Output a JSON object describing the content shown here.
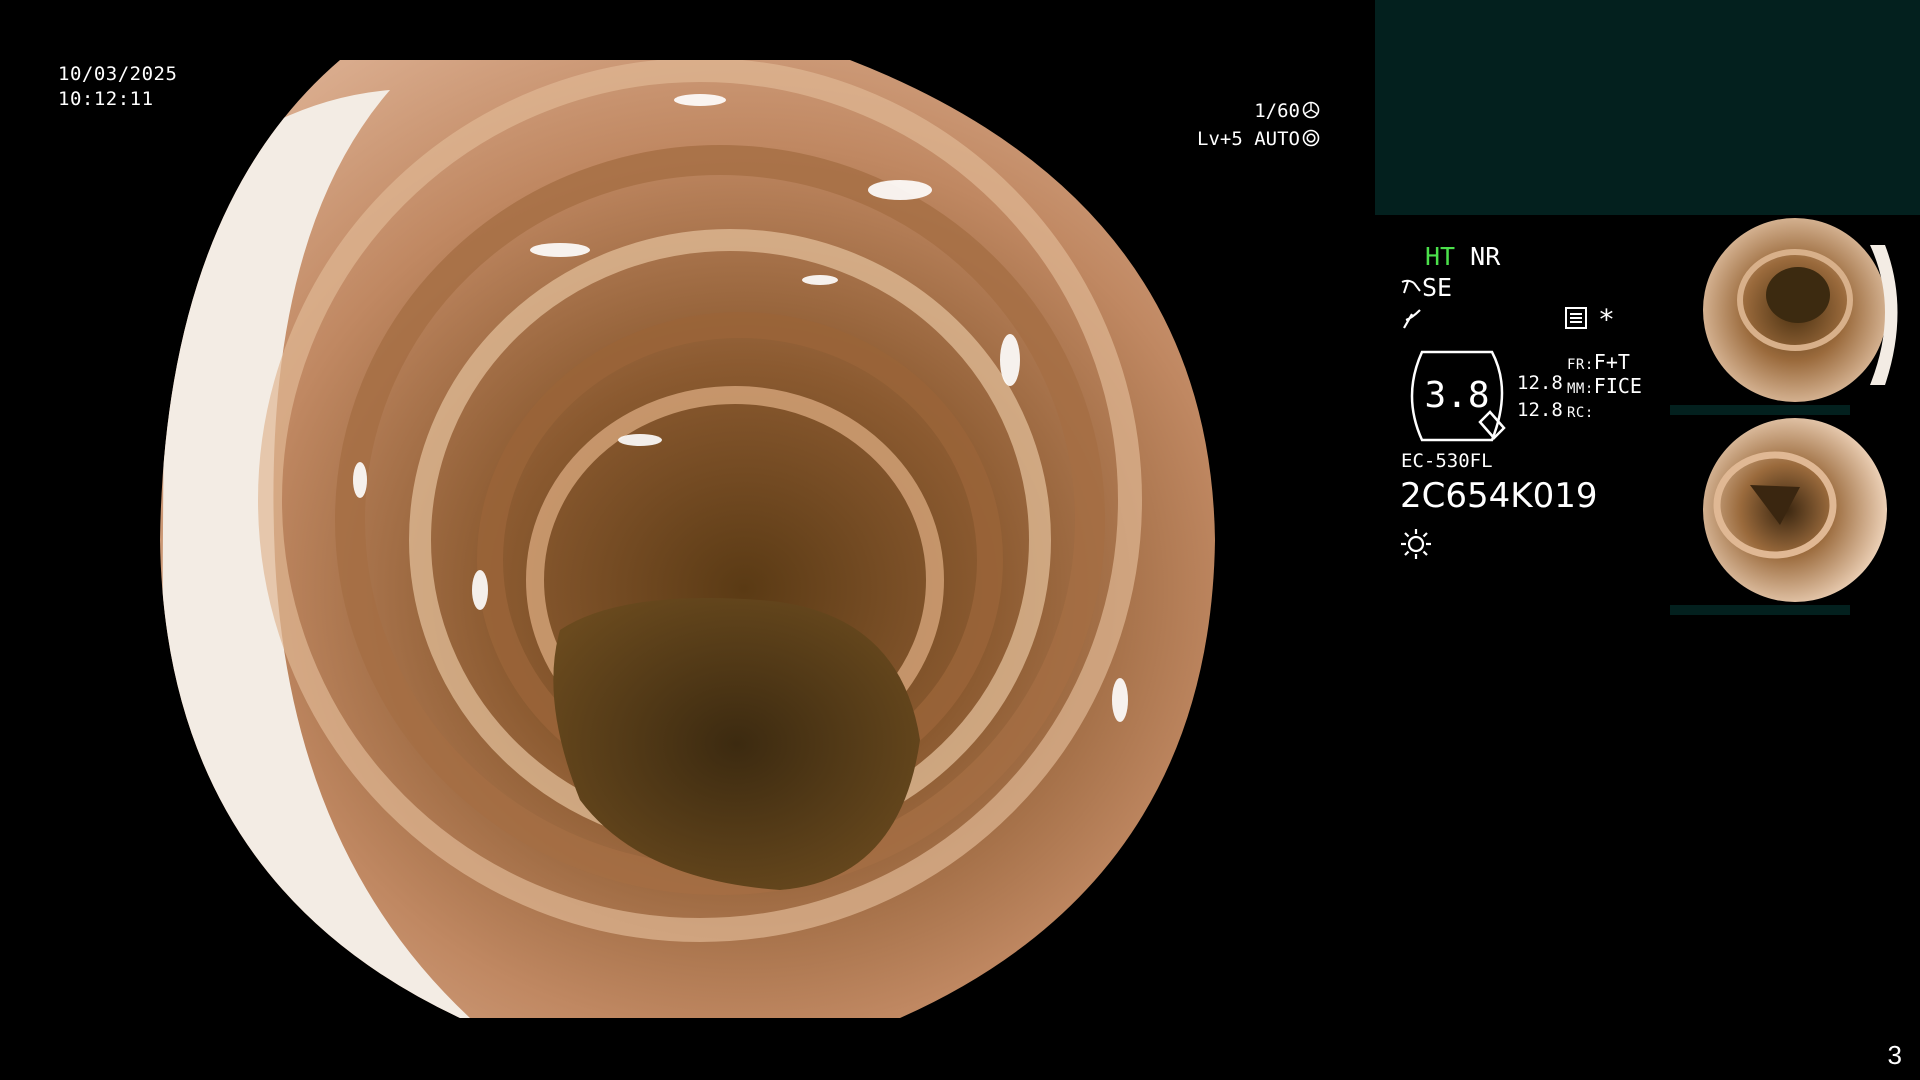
{
  "overlay": {
    "date": "10/03/2025",
    "time": "10:12:11",
    "shutter": "1/60",
    "level": "Lv+5",
    "mode": "AUTO"
  },
  "info_panel": {
    "ht_label": "HT",
    "nr_label": "NR",
    "se_label": "SE",
    "zoom": "3.8",
    "value_top": "12.8",
    "value_bottom": "12.8",
    "fr_label": "FR:",
    "fr_value": "F+T",
    "mm_label": "MM:",
    "mm_value": "FICE",
    "rc_label": "RC:",
    "asterisk": "*",
    "scope_model": "EC-530FL",
    "serial": "2C654K019"
  },
  "footer": {
    "page_number": "3"
  },
  "colors": {
    "background": "#000000",
    "teal_panel": "#03201e",
    "ht_green": "#4be04b",
    "text": "#ffffff"
  },
  "icons": [
    "shutter-icon",
    "auto-iris-icon",
    "scope-tip-icon",
    "lightning-icon",
    "settings-card-icon",
    "zoom-lens-icon",
    "light-sun-icon"
  ]
}
